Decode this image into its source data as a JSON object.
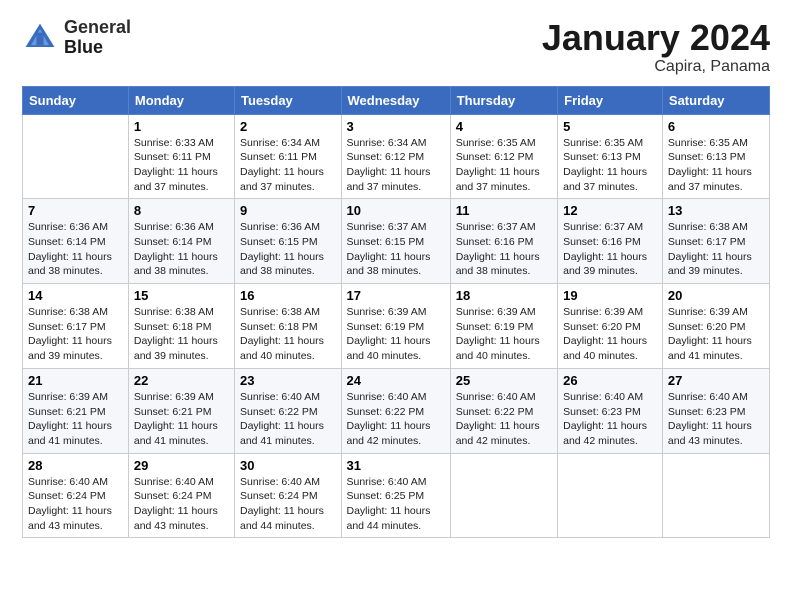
{
  "header": {
    "logo": {
      "line1": "General",
      "line2": "Blue"
    },
    "title": "January 2024",
    "subtitle": "Capira, Panama"
  },
  "days_of_week": [
    "Sunday",
    "Monday",
    "Tuesday",
    "Wednesday",
    "Thursday",
    "Friday",
    "Saturday"
  ],
  "weeks": [
    [
      {
        "day": "",
        "info": ""
      },
      {
        "day": "1",
        "info": "Sunrise: 6:33 AM\nSunset: 6:11 PM\nDaylight: 11 hours\nand 37 minutes."
      },
      {
        "day": "2",
        "info": "Sunrise: 6:34 AM\nSunset: 6:11 PM\nDaylight: 11 hours\nand 37 minutes."
      },
      {
        "day": "3",
        "info": "Sunrise: 6:34 AM\nSunset: 6:12 PM\nDaylight: 11 hours\nand 37 minutes."
      },
      {
        "day": "4",
        "info": "Sunrise: 6:35 AM\nSunset: 6:12 PM\nDaylight: 11 hours\nand 37 minutes."
      },
      {
        "day": "5",
        "info": "Sunrise: 6:35 AM\nSunset: 6:13 PM\nDaylight: 11 hours\nand 37 minutes."
      },
      {
        "day": "6",
        "info": "Sunrise: 6:35 AM\nSunset: 6:13 PM\nDaylight: 11 hours\nand 37 minutes."
      }
    ],
    [
      {
        "day": "7",
        "info": "Sunrise: 6:36 AM\nSunset: 6:14 PM\nDaylight: 11 hours\nand 38 minutes."
      },
      {
        "day": "8",
        "info": "Sunrise: 6:36 AM\nSunset: 6:14 PM\nDaylight: 11 hours\nand 38 minutes."
      },
      {
        "day": "9",
        "info": "Sunrise: 6:36 AM\nSunset: 6:15 PM\nDaylight: 11 hours\nand 38 minutes."
      },
      {
        "day": "10",
        "info": "Sunrise: 6:37 AM\nSunset: 6:15 PM\nDaylight: 11 hours\nand 38 minutes."
      },
      {
        "day": "11",
        "info": "Sunrise: 6:37 AM\nSunset: 6:16 PM\nDaylight: 11 hours\nand 38 minutes."
      },
      {
        "day": "12",
        "info": "Sunrise: 6:37 AM\nSunset: 6:16 PM\nDaylight: 11 hours\nand 39 minutes."
      },
      {
        "day": "13",
        "info": "Sunrise: 6:38 AM\nSunset: 6:17 PM\nDaylight: 11 hours\nand 39 minutes."
      }
    ],
    [
      {
        "day": "14",
        "info": "Sunrise: 6:38 AM\nSunset: 6:17 PM\nDaylight: 11 hours\nand 39 minutes."
      },
      {
        "day": "15",
        "info": "Sunrise: 6:38 AM\nSunset: 6:18 PM\nDaylight: 11 hours\nand 39 minutes."
      },
      {
        "day": "16",
        "info": "Sunrise: 6:38 AM\nSunset: 6:18 PM\nDaylight: 11 hours\nand 40 minutes."
      },
      {
        "day": "17",
        "info": "Sunrise: 6:39 AM\nSunset: 6:19 PM\nDaylight: 11 hours\nand 40 minutes."
      },
      {
        "day": "18",
        "info": "Sunrise: 6:39 AM\nSunset: 6:19 PM\nDaylight: 11 hours\nand 40 minutes."
      },
      {
        "day": "19",
        "info": "Sunrise: 6:39 AM\nSunset: 6:20 PM\nDaylight: 11 hours\nand 40 minutes."
      },
      {
        "day": "20",
        "info": "Sunrise: 6:39 AM\nSunset: 6:20 PM\nDaylight: 11 hours\nand 41 minutes."
      }
    ],
    [
      {
        "day": "21",
        "info": "Sunrise: 6:39 AM\nSunset: 6:21 PM\nDaylight: 11 hours\nand 41 minutes."
      },
      {
        "day": "22",
        "info": "Sunrise: 6:39 AM\nSunset: 6:21 PM\nDaylight: 11 hours\nand 41 minutes."
      },
      {
        "day": "23",
        "info": "Sunrise: 6:40 AM\nSunset: 6:22 PM\nDaylight: 11 hours\nand 41 minutes."
      },
      {
        "day": "24",
        "info": "Sunrise: 6:40 AM\nSunset: 6:22 PM\nDaylight: 11 hours\nand 42 minutes."
      },
      {
        "day": "25",
        "info": "Sunrise: 6:40 AM\nSunset: 6:22 PM\nDaylight: 11 hours\nand 42 minutes."
      },
      {
        "day": "26",
        "info": "Sunrise: 6:40 AM\nSunset: 6:23 PM\nDaylight: 11 hours\nand 42 minutes."
      },
      {
        "day": "27",
        "info": "Sunrise: 6:40 AM\nSunset: 6:23 PM\nDaylight: 11 hours\nand 43 minutes."
      }
    ],
    [
      {
        "day": "28",
        "info": "Sunrise: 6:40 AM\nSunset: 6:24 PM\nDaylight: 11 hours\nand 43 minutes."
      },
      {
        "day": "29",
        "info": "Sunrise: 6:40 AM\nSunset: 6:24 PM\nDaylight: 11 hours\nand 43 minutes."
      },
      {
        "day": "30",
        "info": "Sunrise: 6:40 AM\nSunset: 6:24 PM\nDaylight: 11 hours\nand 44 minutes."
      },
      {
        "day": "31",
        "info": "Sunrise: 6:40 AM\nSunset: 6:25 PM\nDaylight: 11 hours\nand 44 minutes."
      },
      {
        "day": "",
        "info": ""
      },
      {
        "day": "",
        "info": ""
      },
      {
        "day": "",
        "info": ""
      }
    ]
  ]
}
